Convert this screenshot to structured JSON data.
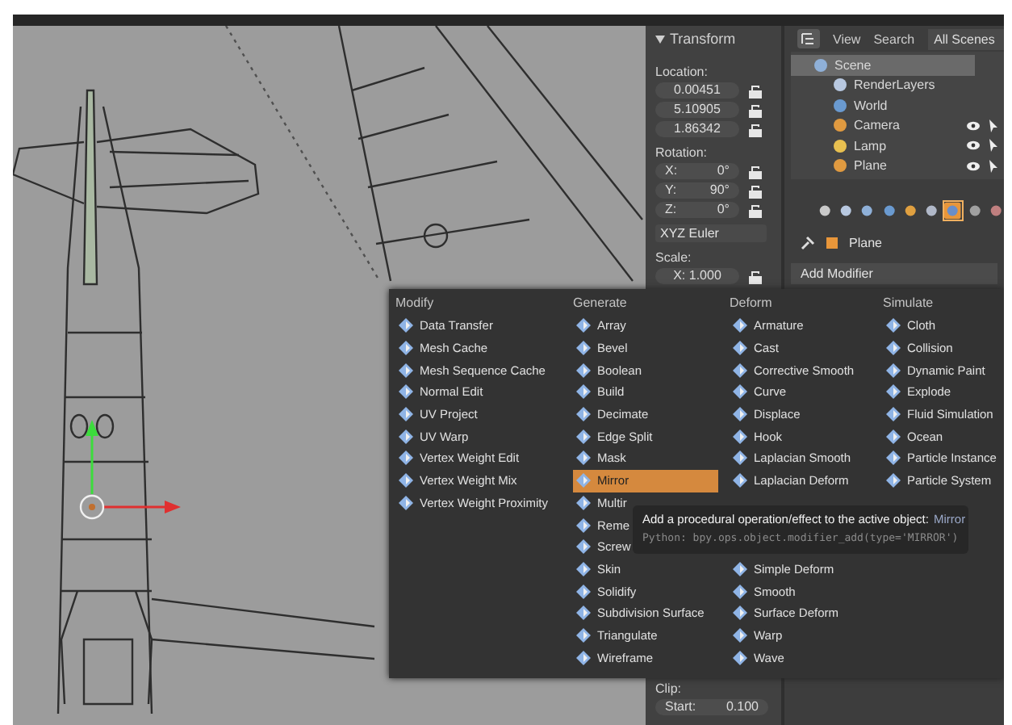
{
  "transform_panel": {
    "title": "Transform",
    "location_label": "Location:",
    "location": [
      "0.00451",
      "5.10905",
      "1.86342"
    ],
    "rotation_label": "Rotation:",
    "rotation": [
      {
        "axis": "X:",
        "value": "0°"
      },
      {
        "axis": "Y:",
        "value": "90°"
      },
      {
        "axis": "Z:",
        "value": "0°"
      }
    ],
    "rotation_mode": "XYZ Euler",
    "scale_label": "Scale:",
    "scale": [
      {
        "axis": "X:",
        "value": "1.000"
      }
    ],
    "clip_label": "Clip:",
    "clip_start": {
      "label": "Start:",
      "value": "0.100"
    }
  },
  "outliner": {
    "menus": [
      "View",
      "Search"
    ],
    "display_mode": "All Scenes",
    "tree": [
      {
        "label": "Scene",
        "kind": "scene",
        "selected": true,
        "visible": false,
        "children": [
          {
            "label": "RenderLayers",
            "kind": "render_layers",
            "selected": false,
            "visible": false
          },
          {
            "label": "World",
            "kind": "world",
            "selected": false,
            "visible": false
          },
          {
            "label": "Camera",
            "kind": "camera",
            "selected": false,
            "visible": true
          },
          {
            "label": "Lamp",
            "kind": "lamp",
            "selected": false,
            "visible": true
          },
          {
            "label": "Plane",
            "kind": "mesh",
            "selected": false,
            "visible": true
          }
        ]
      }
    ]
  },
  "properties": {
    "tabs": [
      {
        "kind": "render",
        "selected": false
      },
      {
        "kind": "render_layers",
        "selected": false
      },
      {
        "kind": "scene",
        "selected": false
      },
      {
        "kind": "world",
        "selected": false
      },
      {
        "kind": "object",
        "selected": false
      },
      {
        "kind": "constraints",
        "selected": false
      },
      {
        "kind": "modifiers",
        "selected": true
      },
      {
        "kind": "data",
        "selected": false
      },
      {
        "kind": "material",
        "selected": false
      }
    ],
    "context": "Plane",
    "add_modifier": "Add Modifier"
  },
  "menu": {
    "columns": [
      {
        "title": "Modify",
        "items": [
          {
            "label": "Data Transfer",
            "selected": false
          },
          {
            "label": "Mesh Cache",
            "selected": false
          },
          {
            "label": "Mesh Sequence Cache",
            "selected": false
          },
          {
            "label": "Normal Edit",
            "selected": false
          },
          {
            "label": "UV Project",
            "selected": false
          },
          {
            "label": "UV Warp",
            "selected": false
          },
          {
            "label": "Vertex Weight Edit",
            "selected": false
          },
          {
            "label": "Vertex Weight Mix",
            "selected": false
          },
          {
            "label": "Vertex Weight Proximity",
            "selected": false
          }
        ]
      },
      {
        "title": "Generate",
        "items": [
          {
            "label": "Array",
            "selected": false
          },
          {
            "label": "Bevel",
            "selected": false
          },
          {
            "label": "Boolean",
            "selected": false
          },
          {
            "label": "Build",
            "selected": false
          },
          {
            "label": "Decimate",
            "selected": false
          },
          {
            "label": "Edge Split",
            "selected": false
          },
          {
            "label": "Mask",
            "selected": false
          },
          {
            "label": "Mirror",
            "selected": true
          },
          {
            "label": "Multir",
            "selected": false
          },
          {
            "label": "Reme",
            "selected": false
          },
          {
            "label": "Screw",
            "selected": false
          },
          {
            "label": "Skin",
            "selected": false
          },
          {
            "label": "Solidify",
            "selected": false
          },
          {
            "label": "Subdivision Surface",
            "selected": false
          },
          {
            "label": "Triangulate",
            "selected": false
          },
          {
            "label": "Wireframe",
            "selected": false
          }
        ]
      },
      {
        "title": "Deform",
        "items": [
          {
            "label": "Armature",
            "selected": false
          },
          {
            "label": "Cast",
            "selected": false
          },
          {
            "label": "Corrective Smooth",
            "selected": false
          },
          {
            "label": "Curve",
            "selected": false
          },
          {
            "label": "Displace",
            "selected": false
          },
          {
            "label": "Hook",
            "selected": false
          },
          {
            "label": "Laplacian Smooth",
            "selected": false
          },
          {
            "label": "Laplacian Deform",
            "selected": false
          }
        ],
        "items_below": [
          {
            "label": "Simple Deform",
            "selected": false
          },
          {
            "label": "Smooth",
            "selected": false
          },
          {
            "label": "Surface Deform",
            "selected": false
          },
          {
            "label": "Warp",
            "selected": false
          },
          {
            "label": "Wave",
            "selected": false
          }
        ]
      },
      {
        "title": "Simulate",
        "items": [
          {
            "label": "Cloth",
            "selected": false
          },
          {
            "label": "Collision",
            "selected": false
          },
          {
            "label": "Dynamic Paint",
            "selected": false
          },
          {
            "label": "Explode",
            "selected": false
          },
          {
            "label": "Fluid Simulation",
            "selected": false
          },
          {
            "label": "Ocean",
            "selected": false
          },
          {
            "label": "Particle Instance",
            "selected": false
          },
          {
            "label": "Particle System",
            "selected": false
          }
        ]
      }
    ]
  },
  "tooltip": {
    "text": "Add a procedural operation/effect to the active object:",
    "name": "Mirror",
    "python": "Python: bpy.ops.object.modifier_add(type='MIRROR')"
  }
}
